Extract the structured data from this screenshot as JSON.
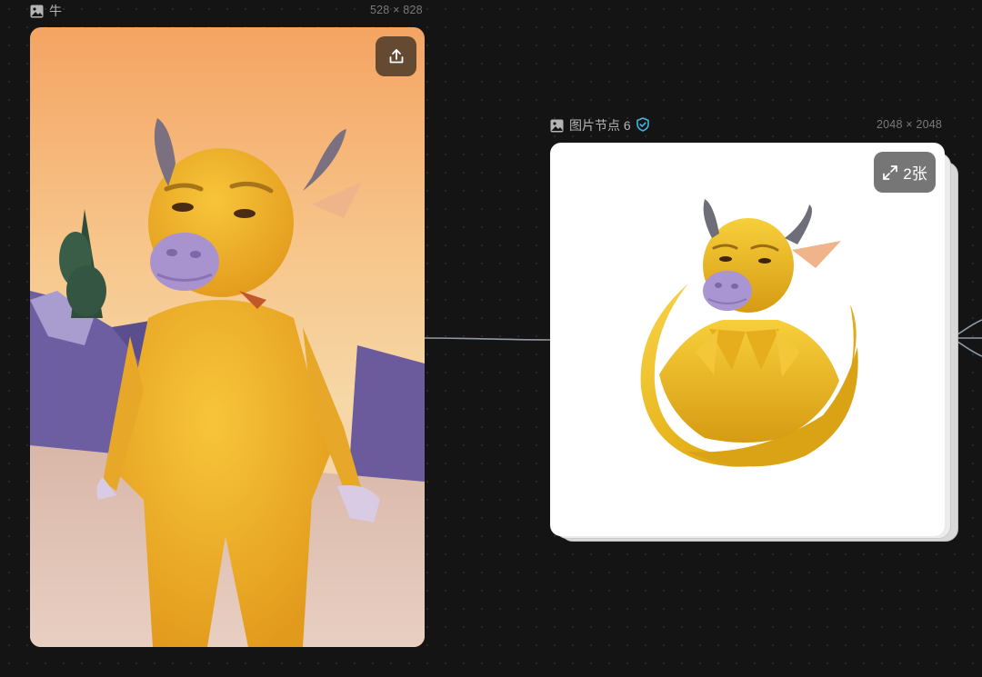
{
  "canvas": {
    "background": "#141414"
  },
  "nodes": [
    {
      "type": "image",
      "title": "牛",
      "dimensions": "528 × 828",
      "action_icon": "upload-icon",
      "content": "photo of a yellow furry bull-costumed character standing in a sunset desert"
    },
    {
      "type": "image",
      "title": "图片节点 6",
      "verified_icon": "shield-check-icon",
      "dimensions": "2048 × 2048",
      "badge": {
        "icon": "expand-icon",
        "label": "2张"
      },
      "content": "golden bull mascot logo with circular swoosh on white background"
    }
  ],
  "colors": {
    "accent": "#3fb7e6",
    "node_bg": "#ffffff",
    "muted_text": "#7a7a7a"
  }
}
